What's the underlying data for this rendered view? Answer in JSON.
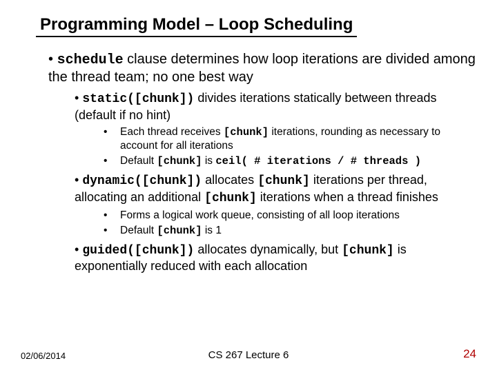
{
  "title": "Programming Model – Loop Scheduling",
  "main": {
    "code": "schedule",
    "rest": " clause determines how loop iterations are divided among the thread team; no one best way"
  },
  "static": {
    "code": "static([chunk])",
    "rest": " divides iterations statically between threads (default if no hint)",
    "sub1a": "Each thread receives ",
    "sub1b": "[chunk]",
    "sub1c": " iterations, rounding as necessary to account for all iterations",
    "sub2a": "Default ",
    "sub2b": "[chunk]",
    "sub2c": " is ",
    "sub2d": "ceil( # iterations / # threads )"
  },
  "dynamic": {
    "code": "dynamic([chunk])",
    "t1": " allocates ",
    "c1": "[chunk]",
    "t2": " iterations per thread, allocating an additional ",
    "c2": "[chunk]",
    "t3": " iterations when a thread finishes",
    "sub1": "Forms a logical work queue, consisting of all loop iterations",
    "sub2a": "Default ",
    "sub2b": "[chunk]",
    "sub2c": " is 1"
  },
  "guided": {
    "code": "guided([chunk])",
    "t1": " allocates dynamically, but ",
    "c1": "[chunk]",
    "t2": " is exponentially reduced with each allocation"
  },
  "footer": {
    "date": "02/06/2014",
    "center": "CS 267 Lecture 6",
    "page": "24"
  }
}
